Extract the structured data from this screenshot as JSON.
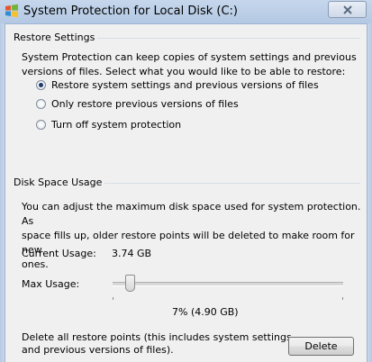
{
  "window": {
    "title": "System Protection for Local Disk (C:)"
  },
  "restore_settings": {
    "group_label": "Restore Settings",
    "description_line1": "System Protection can keep copies of system settings and previous",
    "description_line2": "versions of files. Select what you would like to be able to restore:",
    "options": [
      {
        "label": "Restore system settings and previous versions of files",
        "checked": true
      },
      {
        "label": "Only restore previous versions of files",
        "checked": false
      },
      {
        "label": "Turn off system protection",
        "checked": false
      }
    ]
  },
  "disk_space": {
    "group_label": "Disk Space Usage",
    "description_line1": "You can adjust the maximum disk space used for system protection. As",
    "description_line2": "space fills up, older restore points will be deleted to make room for new",
    "description_line3": "ones.",
    "current_usage_label": "Current Usage:",
    "current_usage_value": "3.74 GB",
    "max_usage_label": "Max Usage:",
    "max_usage_value": "7% (4.90 GB)",
    "max_usage_percent": 7
  },
  "delete_section": {
    "text_line1": "Delete all restore points (this includes system settings",
    "text_line2": "and previous versions of files).",
    "delete_button_label": "Delete"
  },
  "colors": {
    "title_bar": "#c6d7ec",
    "radio_selected": "#1d3a6c",
    "dialog_background": "#f0f0f0"
  },
  "icons": {
    "app": "windows-flag-icon",
    "close": "close-icon"
  }
}
